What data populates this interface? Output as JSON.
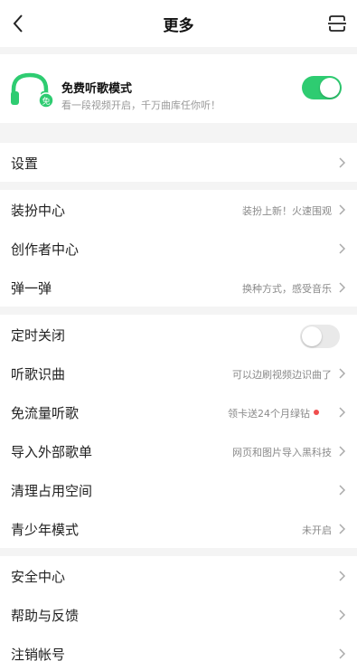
{
  "header": {
    "title": "更多"
  },
  "free_mode": {
    "title": "免费听歌模式",
    "subtitle": "看一段视频开启，千万曲库任你听！",
    "toggle_state": "on",
    "badge": "免"
  },
  "settings": {
    "label": "设置"
  },
  "group2": {
    "dress": {
      "label": "装扮中心",
      "hint": "装扮上新！火速围观"
    },
    "creator": {
      "label": "创作者中心"
    },
    "tan": {
      "label": "弹一弹",
      "hint": "换种方式，感受音乐"
    }
  },
  "group3": {
    "timer": {
      "label": "定时关闭",
      "toggle_state": "off"
    },
    "recognize": {
      "label": "听歌识曲",
      "hint": "可以边刷视频边识曲了"
    },
    "free_flow": {
      "label": "免流量听歌",
      "hint": "领卡送24个月绿钻"
    },
    "import": {
      "label": "导入外部歌单",
      "hint": "网页和图片导入黑科技"
    },
    "clean": {
      "label": "清理占用空间"
    },
    "youth": {
      "label": "青少年模式",
      "hint": "未开启"
    }
  },
  "group4": {
    "security": {
      "label": "安全中心"
    },
    "help": {
      "label": "帮助与反馈"
    },
    "logout": {
      "label": "注销帐号"
    }
  },
  "colors": {
    "accent": "#2ecc71",
    "dot": "#f04e4e",
    "background": "#f4f4f4"
  }
}
